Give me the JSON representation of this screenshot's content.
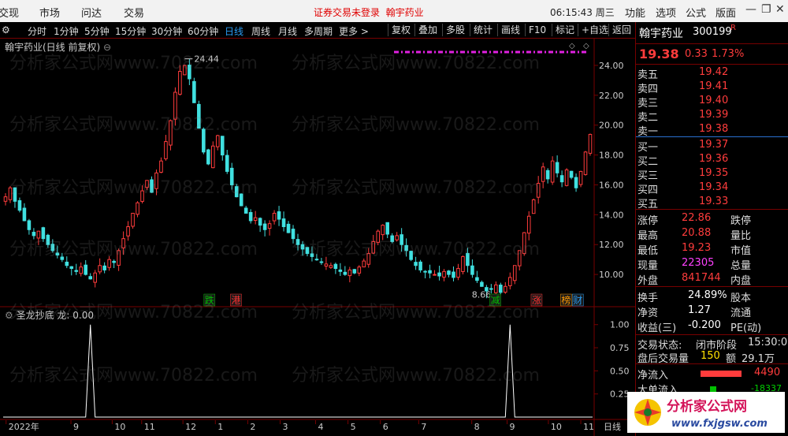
{
  "menu": {
    "items": [
      "交现",
      "市场",
      "问达",
      "交易"
    ],
    "login_status": "证券交易未登录",
    "stock_name": "翰宇药业",
    "clock": "06:15:43 周三",
    "right_items": [
      "功能",
      "选项",
      "公式",
      "版面"
    ],
    "win_min": "—",
    "win_max": "❐",
    "win_close": "✕"
  },
  "periods": {
    "items": [
      "分时",
      "1分钟",
      "5分钟",
      "15分钟",
      "30分钟",
      "60分钟",
      "日线",
      "周线",
      "月线",
      "多周期",
      "更多 >"
    ],
    "active": "日线",
    "tools": [
      "复权",
      "叠加",
      "多股",
      "统计",
      "画线",
      "F10",
      "标记",
      "+自选",
      "返回"
    ]
  },
  "chart_title": "翰宇药业(日线 前复权)",
  "indicator_title": "圣龙抄底 龙: 0.00",
  "watermark": "分析家公式网www.70822.com",
  "chart_data": [
    {
      "type": "candlestick",
      "title": "翰宇药业(日线 前复权)",
      "ylim": [
        8.0,
        25.0
      ],
      "yticks": [
        "24.00",
        "22.00",
        "20.00",
        "18.00",
        "16.00",
        "14.00",
        "12.00",
        "10.00"
      ],
      "ytick_values": [
        24,
        22,
        20,
        18,
        16,
        14,
        12,
        10
      ],
      "xticks": [
        "2022年",
        "9",
        "10",
        "11",
        "12",
        "1",
        "2",
        "3",
        "4",
        "5",
        "6",
        "7",
        "8",
        "9",
        "10",
        "11"
      ],
      "annotations": {
        "high": "24.44",
        "low": "8.66"
      },
      "markers": [
        {
          "label": "跌",
          "color": "#00c000"
        },
        {
          "label": "港",
          "color": "#ff3030"
        },
        {
          "label": "减",
          "color": "#00c000"
        },
        {
          "label": "涨",
          "color": "#ff3030"
        },
        {
          "label": "榜",
          "color": "#ff9900"
        },
        {
          "label": "财",
          "color": "#2a9df4"
        }
      ],
      "closes": [
        15.2,
        15.8,
        14.9,
        14.3,
        13.6,
        13.0,
        12.6,
        12.9,
        12.4,
        12.0,
        11.6,
        11.3,
        11.0,
        10.6,
        10.4,
        10.2,
        10.5,
        10.0,
        9.7,
        10.1,
        10.6,
        10.3,
        11.0,
        10.8,
        11.6,
        12.4,
        13.2,
        14.1,
        14.8,
        15.6,
        16.3,
        15.5,
        16.8,
        17.6,
        18.9,
        20.3,
        22.2,
        23.6,
        24.0,
        23.1,
        21.5,
        19.8,
        18.2,
        17.4,
        18.6,
        19.3,
        18.0,
        16.9,
        16.0,
        15.2,
        14.6,
        14.1,
        13.6,
        13.8,
        13.3,
        13.0,
        13.4,
        14.1,
        13.7,
        13.2,
        12.8,
        12.4,
        12.0,
        11.7,
        11.4,
        11.2,
        11.0,
        10.8,
        10.7,
        10.6,
        10.4,
        10.2,
        10.0,
        10.3,
        10.1,
        10.5,
        10.9,
        11.4,
        12.2,
        12.9,
        13.3,
        12.7,
        12.2,
        12.6,
        12.0,
        11.6,
        11.0,
        10.6,
        10.3,
        10.2,
        10.1,
        10.0,
        9.9,
        10.2,
        10.0,
        9.8,
        10.4,
        11.2,
        10.6,
        10.0,
        9.6,
        9.2,
        8.9,
        9.0,
        9.3,
        8.8,
        9.2,
        9.8,
        10.6,
        11.6,
        12.8,
        13.9,
        15.0,
        16.1,
        17.2,
        16.4,
        17.6,
        16.8,
        16.2,
        17.0,
        16.5,
        15.8,
        16.9,
        18.2,
        19.38
      ],
      "y2lim": [
        0,
        1.1
      ],
      "y2ticks": [
        "1.00",
        "0.75",
        "0.50",
        "0.25"
      ],
      "y2tick_values": [
        1.0,
        0.75,
        0.5,
        0.25
      ],
      "signal_values": [
        0,
        0,
        0,
        0,
        0,
        0,
        0,
        0,
        0,
        0,
        0,
        0,
        0,
        0,
        0,
        0,
        0,
        0,
        0,
        0,
        0,
        0,
        0,
        0,
        0,
        0,
        0,
        0,
        0,
        0,
        0,
        0,
        0,
        0,
        0,
        0,
        0,
        0,
        0,
        0,
        0,
        0,
        0,
        0,
        0,
        0,
        0,
        0,
        0,
        0,
        0,
        0,
        0,
        0,
        0,
        0,
        0,
        0,
        0,
        0,
        0,
        0,
        0,
        0,
        0,
        0,
        0,
        0,
        0,
        0,
        0,
        0,
        0,
        0,
        0,
        0,
        0,
        0,
        0,
        0,
        0,
        0,
        0,
        0,
        0,
        0,
        0,
        0,
        0,
        0,
        0,
        0,
        0,
        0,
        0,
        0,
        0,
        0,
        0,
        0,
        0,
        0,
        0,
        0,
        0,
        0,
        0,
        0,
        0,
        0,
        0,
        0,
        0,
        0,
        0,
        0,
        0,
        0,
        0,
        0,
        0,
        0,
        0,
        0,
        0
      ],
      "signal_peaks": [
        {
          "x_label": "9",
          "value": 1.0
        },
        {
          "x_label": "9b",
          "value": 1.0
        }
      ],
      "series_color_up": "#ff3c3c",
      "series_color_down": "#40e0e0",
      "hline_color": "#e020e0"
    }
  ],
  "quote": {
    "name": "翰宇药业",
    "code": "300199",
    "flag": "R",
    "price": "19.38",
    "change": "0.33",
    "pct": "1.73%",
    "asks": [
      {
        "label": "卖五",
        "price": "19.42"
      },
      {
        "label": "卖四",
        "price": "19.41"
      },
      {
        "label": "卖三",
        "price": "19.40"
      },
      {
        "label": "卖二",
        "price": "19.39"
      },
      {
        "label": "卖一",
        "price": "19.38"
      }
    ],
    "bids": [
      {
        "label": "买一",
        "price": "19.37"
      },
      {
        "label": "买二",
        "price": "19.36"
      },
      {
        "label": "买三",
        "price": "19.35"
      },
      {
        "label": "买四",
        "price": "19.34"
      },
      {
        "label": "买五",
        "price": "19.33"
      }
    ],
    "stats": [
      {
        "l": "涨停",
        "v": "22.86",
        "r": "跌停"
      },
      {
        "l": "最高",
        "v": "20.88",
        "r": "量比"
      },
      {
        "l": "最低",
        "v": "19.23",
        "r": "市值"
      },
      {
        "l": "现量",
        "v": "22305",
        "r": "总量"
      },
      {
        "l": "外盘",
        "v": "841744",
        "r": "内盘"
      }
    ],
    "stats2": [
      {
        "l": "换手",
        "v": "24.89%",
        "r": "股本"
      },
      {
        "l": "净资",
        "v": "1.27",
        "r": "流通"
      },
      {
        "l": "收益(三)",
        "v": "-0.200",
        "r": "PE(动)"
      }
    ],
    "trade_status_label": "交易状态:",
    "trade_status": "闭市阶段",
    "trade_time": "15:30:0",
    "after_label": "盘后交易量",
    "after_vol": "150",
    "after_amount_label": "额",
    "after_amount": "29.1万",
    "net_in_label": "净流入",
    "net_in": "4490",
    "big_in_label": "大单流入",
    "big_in": "-18337"
  },
  "logo": {
    "text": "分析家公式网",
    "url": "www.fxjgsw.com"
  }
}
